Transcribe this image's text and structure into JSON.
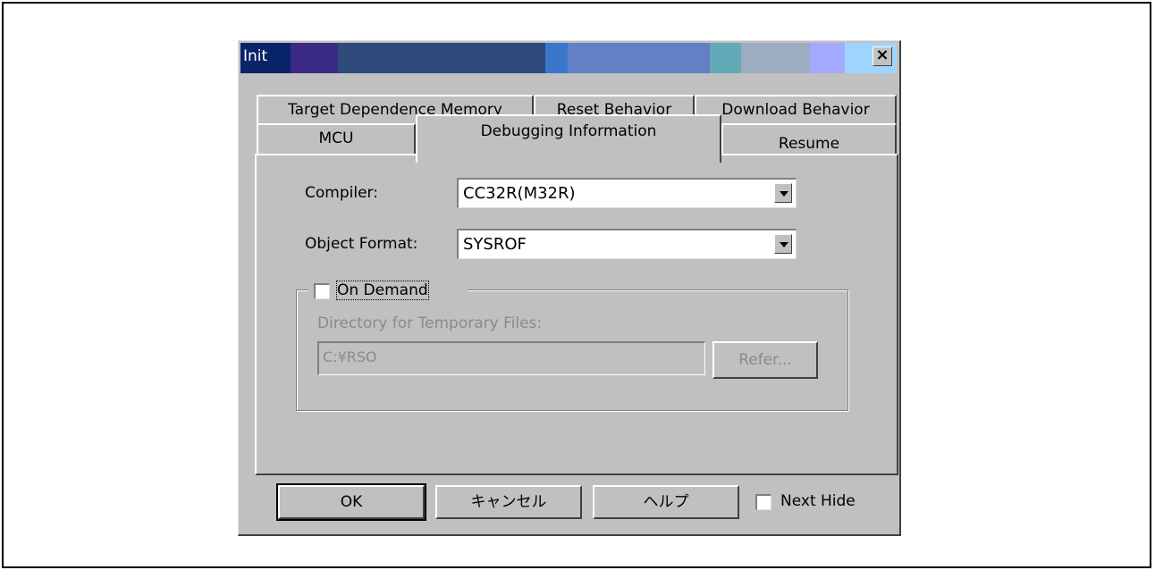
{
  "window": {
    "title": "Init"
  },
  "tabs": {
    "row1": [
      "Target Dependence Memory",
      "Reset Behavior",
      "Download Behavior"
    ],
    "row2": [
      "MCU",
      "Debugging Information",
      "Resume"
    ],
    "active": "Debugging Information"
  },
  "form": {
    "compiler_label": "Compiler:",
    "compiler_value": "CC32R(M32R)",
    "object_format_label": "Object Format:",
    "object_format_value": "SYSROF",
    "on_demand_label": "On Demand",
    "on_demand_checked": false,
    "temp_dir_label": "Directory for Temporary Files:",
    "temp_dir_value": "C:¥RSO",
    "refer_label": "Refer..."
  },
  "buttons": {
    "ok": "OK",
    "cancel": "キャンセル",
    "help": "ヘルプ",
    "next_hide_label": "Next Hide",
    "next_hide_checked": false
  },
  "colors": {
    "titlebar_segments": [
      "#0a246a",
      "#3b2a85",
      "#2e4a7a",
      "#2e4a7a",
      "#2e4a7a",
      "#3a76cc",
      "#6380c4",
      "#6380c4",
      "#62aab7",
      "#9cadc2",
      "#a3a9ff",
      "#9ed5ff"
    ],
    "face": "#c0c0c0",
    "disabled_text": "#8a8a8a"
  }
}
